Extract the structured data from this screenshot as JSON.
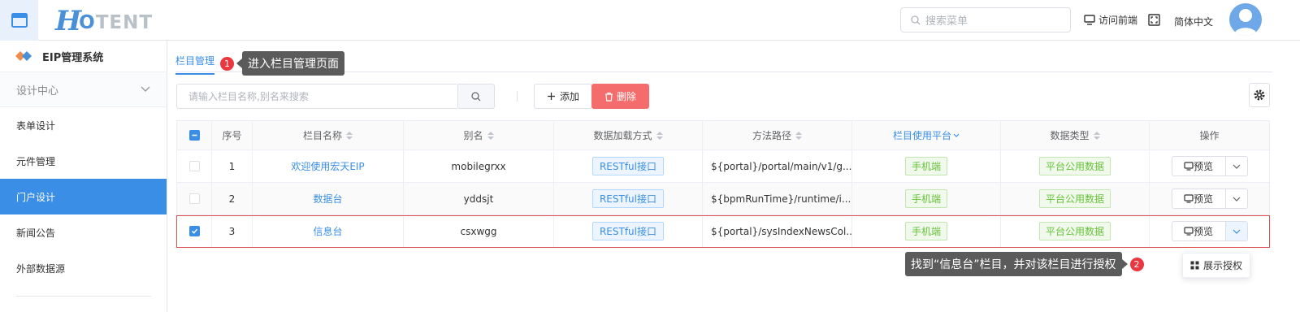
{
  "header": {
    "logo_h": "H",
    "logo_rest_o": "O",
    "logo_rest": "TENT",
    "search_placeholder": "搜索菜单",
    "visit_label": "访问前端",
    "lang_label": "简体中文"
  },
  "sidebar": {
    "system_title": "EIP管理系统",
    "group_label": "设计中心",
    "items": [
      {
        "label": "表单设计",
        "active": false
      },
      {
        "label": "元件管理",
        "active": false
      },
      {
        "label": "门户设计",
        "active": true
      },
      {
        "label": "新闻公告",
        "active": false
      },
      {
        "label": "外部数据源",
        "active": false
      }
    ]
  },
  "main": {
    "tab_label": "栏目管理",
    "steps": [
      {
        "num": "1",
        "text": "进入栏目管理页面"
      },
      {
        "num": "2",
        "text": "找到“信息台”栏目，并对该栏目进行授权"
      }
    ],
    "search_placeholder": "请输入栏目名称,别名来搜索",
    "add_label": "添加",
    "delete_label": "删除",
    "auth_button_label": "展示授权"
  },
  "table": {
    "columns": [
      "序号",
      "栏目名称",
      "别名",
      "数据加载方式",
      "方法路径",
      "栏目使用平台",
      "数据类型",
      "操作"
    ],
    "rows": [
      {
        "index": "1",
        "name": "欢迎使用宏天EIP",
        "alias": "mobilegrxx",
        "load": "RESTful接口",
        "path": "${portal}/portal/main/v1/g...",
        "platform": "手机端",
        "dtype": "平台公用数据",
        "action": "预览",
        "checked": false
      },
      {
        "index": "2",
        "name": "数据台",
        "alias": "yddsjt",
        "load": "RESTful接口",
        "path": "${bpmRunTime}/runtime/i...",
        "platform": "手机端",
        "dtype": "平台公用数据",
        "action": "预览",
        "checked": false
      },
      {
        "index": "3",
        "name": "信息台",
        "alias": "csxwgg",
        "load": "RESTful接口",
        "path": "${portal}/sysIndexNewsCol...",
        "platform": "手机端",
        "dtype": "平台公用数据",
        "action": "预览",
        "checked": true
      }
    ]
  },
  "colors": {
    "primary": "#3a8ee6",
    "danger": "#f56c6c",
    "step_badge": "#e9383f",
    "tooltip_bg": "#5b5b5b"
  }
}
